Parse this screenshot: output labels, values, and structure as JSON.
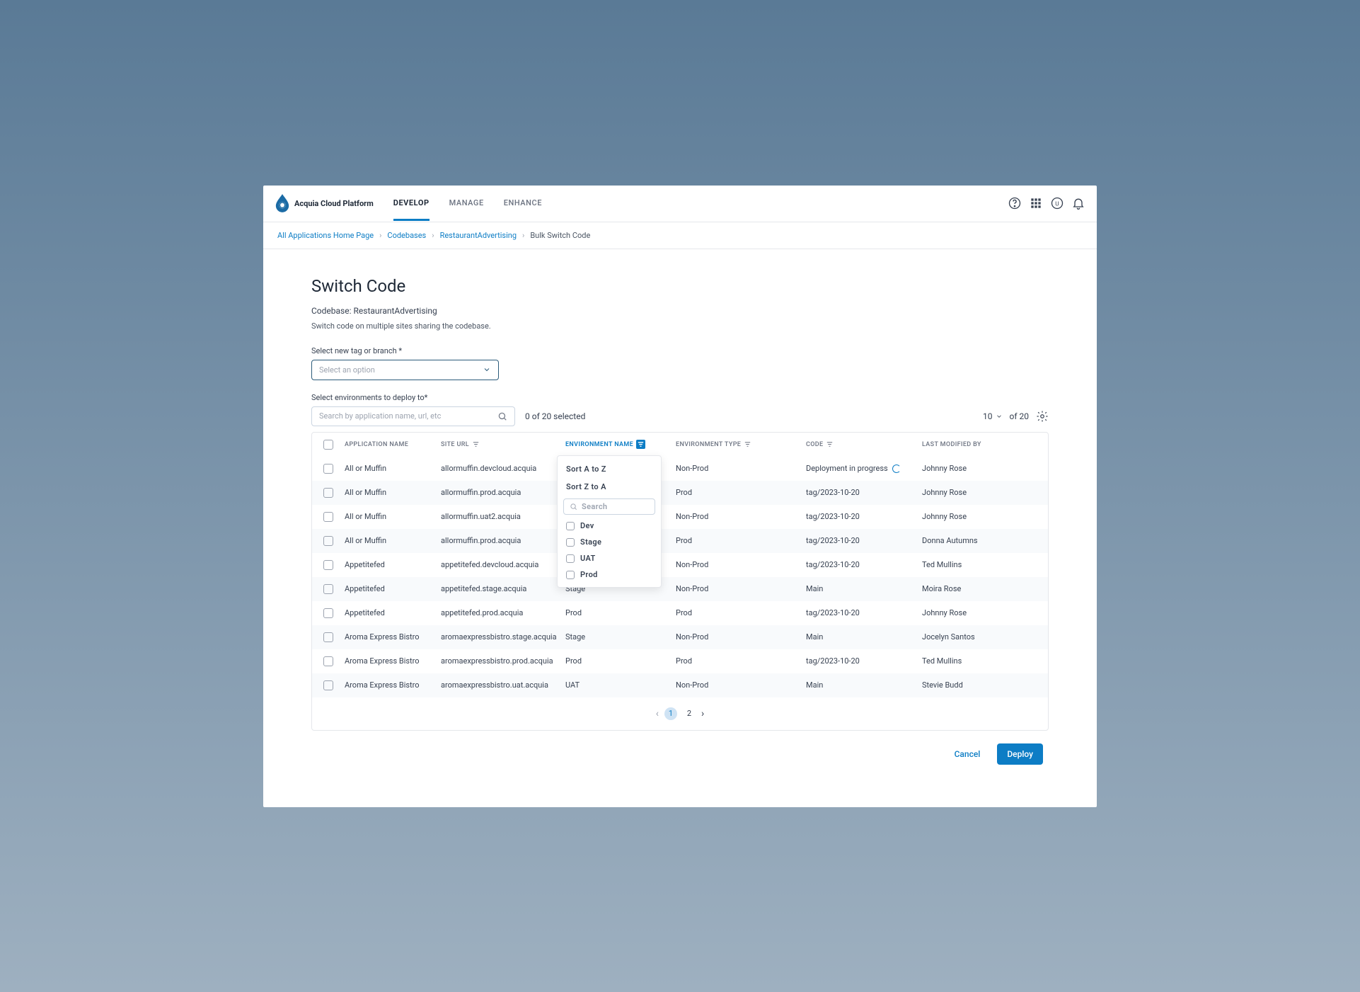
{
  "brand": "Acquia Cloud Platform",
  "tabs": [
    "DEVELOP",
    "MANAGE",
    "ENHANCE"
  ],
  "breadcrumb": {
    "home": "All Applications Home Page",
    "codebases": "Codebases",
    "project": "RestaurantAdvertising",
    "current": "Bulk Switch Code"
  },
  "page": {
    "title": "Switch Code",
    "subtitle": "Codebase: RestaurantAdvertising",
    "desc": "Switch code on multiple sites sharing the codebase.",
    "tag_label": "Select new tag or branch *",
    "tag_placeholder": "Select an option",
    "env_label": "Select environments to deploy to*",
    "search_placeholder": "Search by application name, url, etc",
    "selected": "0 of 20 selected",
    "page_size": "10",
    "page_total": "of 20"
  },
  "columns": {
    "app": "APPLICATION NAME",
    "url": "SITE URL",
    "env_name": "ENVIRONMENT NAME",
    "env_type": "ENVIRONMENT TYPE",
    "code": "CODE",
    "modified": "LAST MODIFIED BY"
  },
  "rows": [
    {
      "app": "All or Muffin",
      "url": "allormuffin.devcloud.acquia",
      "env": "",
      "type": "Non-Prod",
      "code": "Deployment in progress",
      "codeSpinner": true,
      "by": "Johnny Rose"
    },
    {
      "app": "All or Muffin",
      "url": "allormuffin.prod.acquia",
      "env": "",
      "type": "Prod",
      "code": "tag/2023-10-20",
      "by": "Johnny Rose"
    },
    {
      "app": "All or Muffin",
      "url": "allormuffin.uat2.acquia",
      "env": "",
      "type": "Non-Prod",
      "code": "tag/2023-10-20",
      "by": "Johnny Rose"
    },
    {
      "app": "All or Muffin",
      "url": "allormuffin.prod.acquia",
      "env": "",
      "type": "Prod",
      "code": "tag/2023-10-20",
      "by": "Donna Autumns"
    },
    {
      "app": "Appetitefed",
      "url": "appetitefed.devcloud.acquia",
      "env": "",
      "type": "Non-Prod",
      "code": "tag/2023-10-20",
      "by": "Ted Mullins"
    },
    {
      "app": "Appetitefed",
      "url": "appetitefed.stage.acquia",
      "env": "Stage",
      "type": "Non-Prod",
      "code": "Main",
      "by": "Moira Rose"
    },
    {
      "app": "Appetitefed",
      "url": "appetitefed.prod.acquia",
      "env": "Prod",
      "type": "Prod",
      "code": "tag/2023-10-20",
      "by": "Johnny Rose"
    },
    {
      "app": "Aroma Express Bistro",
      "url": "aromaexpressbistro.stage.acquia",
      "env": "Stage",
      "type": "Non-Prod",
      "code": "Main",
      "by": "Jocelyn Santos"
    },
    {
      "app": "Aroma Express Bistro",
      "url": "aromaexpressbistro.prod.acquia",
      "env": "Prod",
      "type": "Prod",
      "code": "tag/2023-10-20",
      "by": "Ted Mullins"
    },
    {
      "app": "Aroma Express Bistro",
      "url": "aromaexpressbistro.uat.acquia",
      "env": "UAT",
      "type": "Non-Prod",
      "code": "Main",
      "by": "Stevie Budd"
    }
  ],
  "dropdown": {
    "sort_az": "Sort A to Z",
    "sort_za": "Sort Z to A",
    "search": "Search",
    "options": [
      "Dev",
      "Stage",
      "UAT",
      "Prod"
    ]
  },
  "pager": {
    "pages": [
      "1",
      "2"
    ]
  },
  "actions": {
    "cancel": "Cancel",
    "deploy": "Deploy"
  }
}
